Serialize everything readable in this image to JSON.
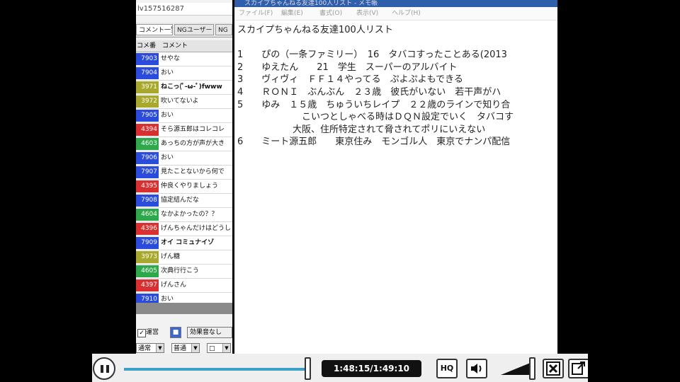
{
  "comment_panel": {
    "live_id": "lv157516287",
    "tabs": [
      "コメント一覧",
      "NGユーザー",
      "NG"
    ],
    "columns": [
      "コメ番",
      "コメント"
    ],
    "comments": [
      {
        "num": "7903",
        "text": "せやな",
        "color": "#2b4bdc",
        "bold": false
      },
      {
        "num": "7904",
        "text": "おい",
        "color": "#2b4bdc",
        "bold": false
      },
      {
        "num": "3971",
        "text": "ねこっ(ﾟ-ω-ﾟ)fwww",
        "color": "#a8a82c",
        "bold": true
      },
      {
        "num": "3972",
        "text": "吹いてないよ",
        "color": "#a8a82c",
        "bold": false
      },
      {
        "num": "7905",
        "text": "おい",
        "color": "#2b4bdc",
        "bold": false
      },
      {
        "num": "4394",
        "text": "そら源五郎はコレコレ",
        "color": "#d83030",
        "bold": false
      },
      {
        "num": "4603",
        "text": "あっちの方が声が大き",
        "color": "#2ea84a",
        "bold": false
      },
      {
        "num": "7906",
        "text": "おい",
        "color": "#2b4bdc",
        "bold": false
      },
      {
        "num": "7907",
        "text": "見たことないから何で",
        "color": "#2b4bdc",
        "bold": false
      },
      {
        "num": "4395",
        "text": "仲良くやりましょう",
        "color": "#d83030",
        "bold": false
      },
      {
        "num": "7908",
        "text": "協定結んだな",
        "color": "#2b4bdc",
        "bold": false
      },
      {
        "num": "4604",
        "text": "なかよかったの？？",
        "color": "#2ea84a",
        "bold": false
      },
      {
        "num": "4396",
        "text": "げんちゃんだけはどうし",
        "color": "#d83030",
        "bold": false
      },
      {
        "num": "7909",
        "text": "オイ コミュナイゾ",
        "color": "#2b4bdc",
        "bold": true
      },
      {
        "num": "3973",
        "text": "げん糖",
        "color": "#a8a82c",
        "bold": false
      },
      {
        "num": "4605",
        "text": "次典行行こう",
        "color": "#2ea84a",
        "bold": false
      },
      {
        "num": "4397",
        "text": "げんさん",
        "color": "#d83030",
        "bold": false
      },
      {
        "num": "7910",
        "text": "おい",
        "color": "#2b4bdc",
        "bold": false
      }
    ],
    "controls": {
      "operator_label": "運営",
      "operator_checked": true,
      "no_effect_label": "効果音なし",
      "select1": "通常",
      "select2": "普通",
      "select3": "□"
    }
  },
  "notepad": {
    "title": "スカイプちゃんねる友達100人リスト - メモ帳",
    "menu": [
      "ファイル(F)",
      "編集(E)",
      "書式(O)",
      "表示(V)",
      "ヘルプ(H)"
    ],
    "lines": [
      "スカイプちゃんねる友達100人リスト",
      "",
      "1　　ぴの（一条ファミリー）　16　タバコすったことある(2013",
      "2　　ゆえたん　　21　学生　スーパーのアルバイト",
      "3　　ヴィヴィ　ＦＦ１４やってる　ぷよぷよもできる",
      "4　　ＲＯＮＩ　ぶんぶん　２３歳　彼氏がいない　若干声がハ",
      "5　　ゆみ　１５歳　ちゅういちレイプ　２２歳のラインで知り合",
      "　　　　　　　こいつとしゃべる時はＤＱＮ設定でいく　タバコす",
      "　　　　　　大阪、住所特定されて脅されてポリにいえない",
      "6　　ミート源五郎　　東京住み　モンゴル人　東京でナンパ配信"
    ]
  },
  "player": {
    "time_display": "1:48:15/1:49:10",
    "progress": 0.99,
    "hq_label": "HQ",
    "volume": 0.95
  }
}
